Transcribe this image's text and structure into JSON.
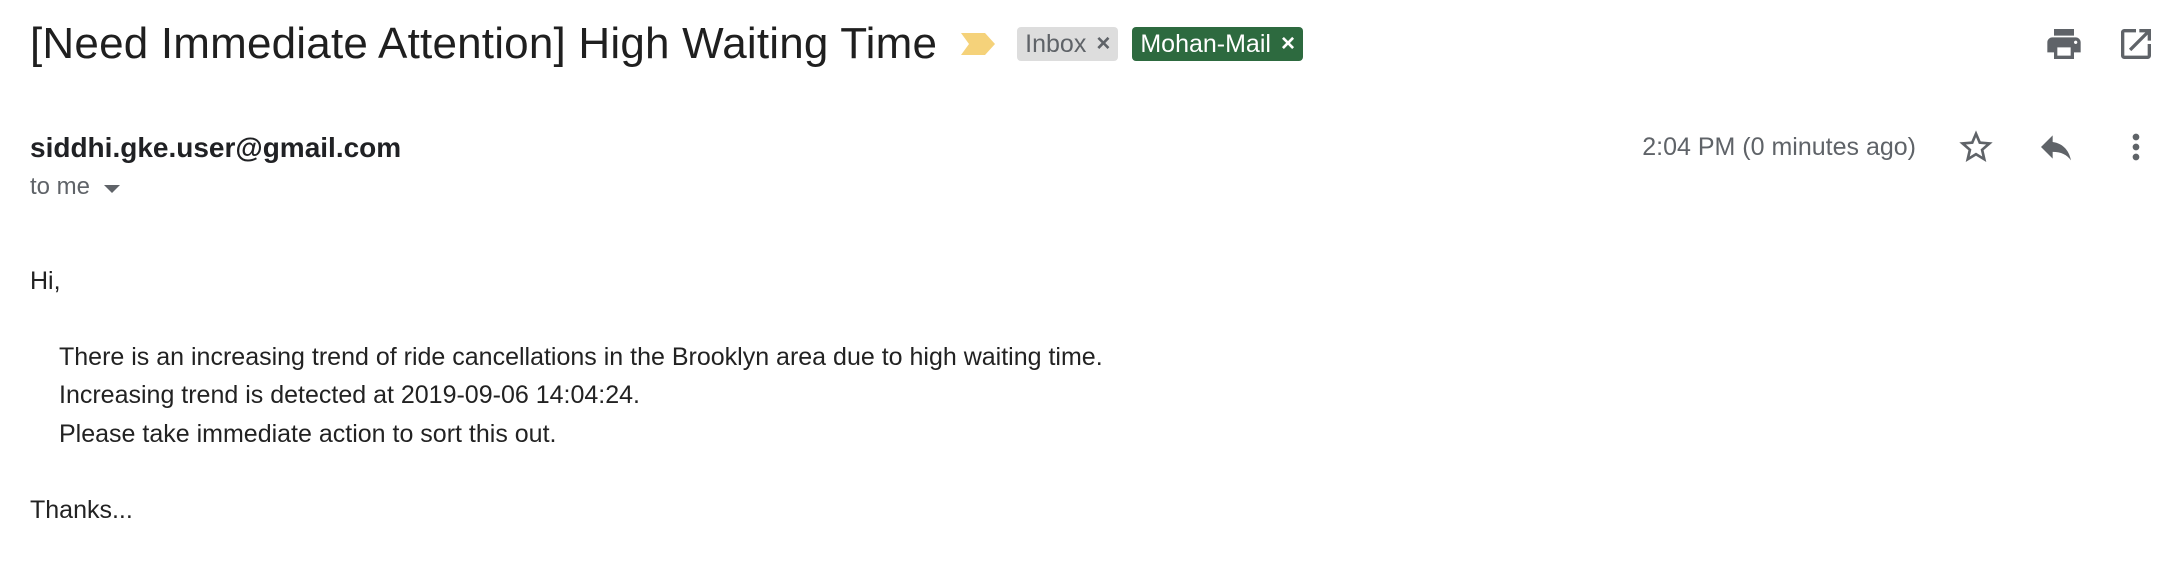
{
  "email": {
    "subject": "[Need Immediate Attention] High Waiting Time",
    "labels": [
      {
        "name": "Inbox",
        "remove": "×"
      },
      {
        "name": "Mohan-Mail",
        "remove": "×"
      }
    ],
    "sender": "siddhi.gke.user@gmail.com",
    "recipient": "to me",
    "timestamp": "2:04 PM (0 minutes ago)",
    "body": {
      "greeting": "Hi,",
      "lines": [
        "There is an increasing trend of ride cancellations in the Brooklyn area due to high waiting time.",
        "Increasing trend is detected at 2019-09-06 14:04:24.",
        "Please take immediate action to sort this out."
      ],
      "signoff": "Thanks..."
    }
  },
  "icons": {
    "importance": "importance-marker-icon",
    "print": "print-icon",
    "open_new_window": "open-in-new-window-icon",
    "star": "star-icon",
    "reply": "reply-icon",
    "more": "more-vertical-icon"
  },
  "colors": {
    "importance_marker": "#f5d27a",
    "inbox_chip_bg": "#dddddd",
    "mohan_chip_bg": "#2d6a3f",
    "icon_gray": "#5f6368"
  }
}
